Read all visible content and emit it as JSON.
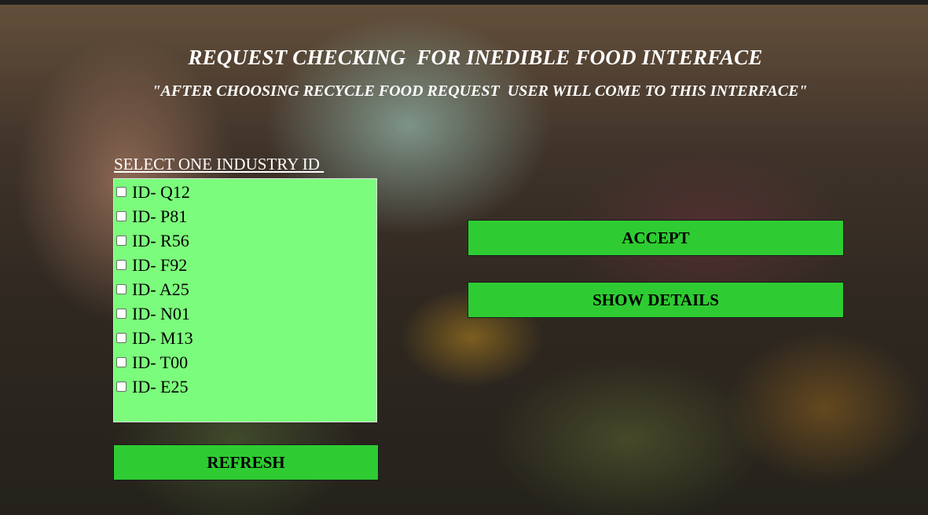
{
  "header": {
    "title": "REQUEST CHECKING  FOR INEDIBLE FOOD INTERFACE",
    "subtitle": "\"AFTER CHOOSING RECYCLE FOOD REQUEST  USER WILL COME TO THIS INTERFACE\""
  },
  "selector": {
    "label": "SELECT ONE INDUSTRY ID ",
    "items": [
      {
        "label": "ID- Q12",
        "checked": false
      },
      {
        "label": "ID- P81",
        "checked": false
      },
      {
        "label": "ID- R56",
        "checked": false
      },
      {
        "label": "ID- F92",
        "checked": false
      },
      {
        "label": "ID- A25",
        "checked": false
      },
      {
        "label": "ID- N01",
        "checked": false
      },
      {
        "label": "ID- M13",
        "checked": false
      },
      {
        "label": "ID- T00",
        "checked": false
      },
      {
        "label": "ID- E25",
        "checked": false
      }
    ]
  },
  "buttons": {
    "accept": "ACCEPT",
    "show_details": "SHOW DETAILS",
    "refresh": "REFRESH"
  },
  "colors": {
    "button_green": "#2ecc32",
    "list_green": "#7cfc7c",
    "text_white": "#ffffff"
  }
}
